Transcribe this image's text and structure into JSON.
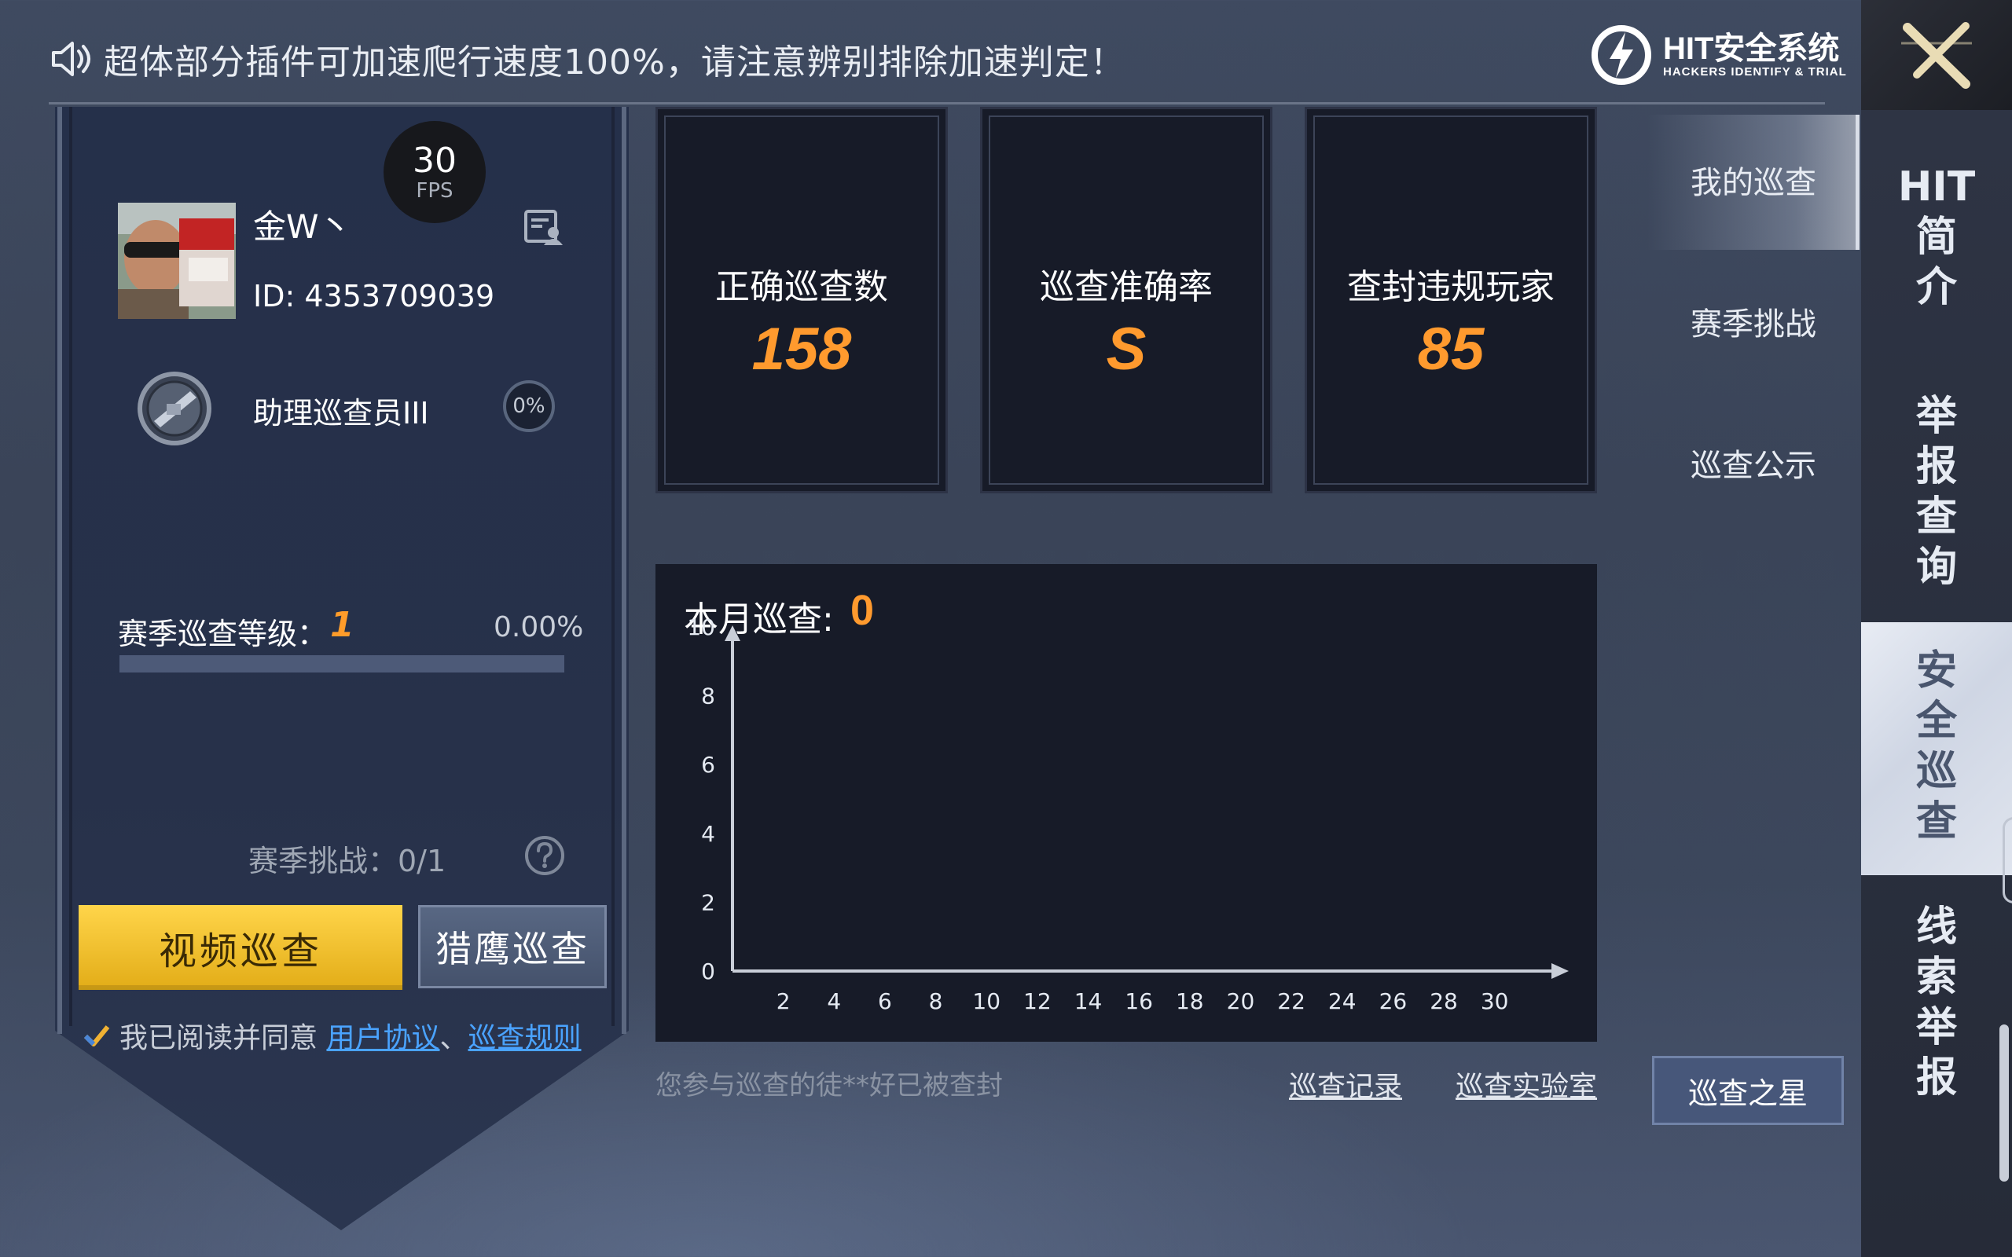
{
  "announcement": {
    "icon": "speaker-icon",
    "text": "超体部分插件可加速爬行速度100%，请注意辨别排除加速判定！"
  },
  "brand": {
    "name": "HIT安全系统",
    "tagline": "HACKERS IDENTIFY & TRIAL"
  },
  "fps": {
    "value": "30",
    "unit": "FPS"
  },
  "profile": {
    "username": "金W丶",
    "id": "ID: 4353709039",
    "rank_name": "助理巡查员III",
    "rank_progress": "0%"
  },
  "season": {
    "label": "赛季巡查等级：",
    "level": "1",
    "percent": "0.00%",
    "progress_fraction": 0,
    "challenge": "赛季挑战：0/1"
  },
  "buttons": {
    "video_patrol": "视频巡查",
    "hawk_patrol": "猎鹰巡查",
    "patrol_star": "巡查之星"
  },
  "agreement": {
    "prefix": "我已阅读并同意",
    "user_agreement": "用户协议",
    "separator": "、",
    "patrol_rules": "巡查规则",
    "checked": true
  },
  "stats": [
    {
      "label": "正确巡查数",
      "value": "158"
    },
    {
      "label": "巡查准确率",
      "value": "S"
    },
    {
      "label": "查封违规玩家",
      "value": "85"
    }
  ],
  "monthly": {
    "title": "本月巡查:",
    "count": "0"
  },
  "chart_data": {
    "type": "line",
    "x_ticks": [
      2,
      4,
      6,
      8,
      10,
      12,
      14,
      16,
      18,
      20,
      22,
      24,
      26,
      28,
      30
    ],
    "y_ticks": [
      0,
      2,
      4,
      6,
      8,
      10
    ],
    "xlim": [
      0,
      31
    ],
    "ylim": [
      0,
      10
    ],
    "series": [],
    "grid": false
  },
  "footer": {
    "banned_note": "您参与巡查的徒**好已被查封",
    "record_link": "巡查记录",
    "lab_link": "巡查实验室"
  },
  "sub_menu": [
    "我的巡查",
    "赛季挑战",
    "巡查公示"
  ],
  "right_nav": [
    {
      "label": "HIT简介",
      "lines": [
        "HIT",
        "简",
        "介"
      ]
    },
    {
      "label": "举报查询",
      "lines": [
        "举",
        "报",
        "查",
        "询"
      ]
    },
    {
      "label": "安全巡查",
      "lines": [
        "安",
        "全",
        "巡",
        "查"
      ]
    },
    {
      "label": "线索举报",
      "lines": [
        "线",
        "索",
        "举",
        "报"
      ]
    }
  ],
  "colors": {
    "accent_orange": "#ff9a2e",
    "button_yellow": "#ffd54a",
    "link_blue": "#4aa3ff",
    "card_bg": "#171b28"
  }
}
